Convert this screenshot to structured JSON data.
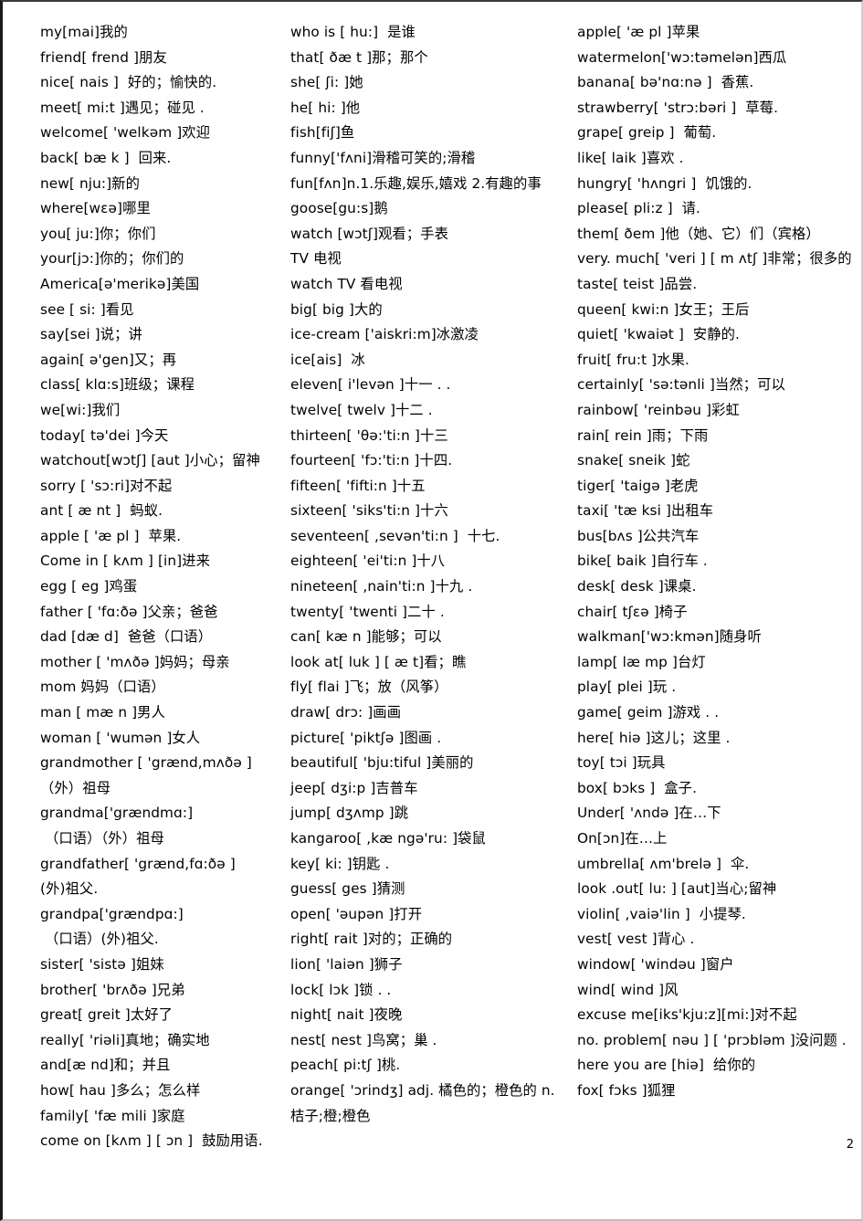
{
  "document": {
    "type": "vocabulary-word-list",
    "page_number": "2",
    "column_count": 3
  },
  "columns": [
    {
      "id": "column-1",
      "entries": [
        "my[mai]我的",
        "friend[ frend ]朋友",
        "nice[ nais ]  好的；愉快的.",
        "meet[ mi:t ]遇见；碰见 .",
        "welcome[ 'welkəm ]欢迎",
        "back[ bæ k ]  回来.",
        "new[ nju:]新的",
        "where[wɛə]哪里",
        "you[ ju:]你；你们",
        "your[jɔ:]你的；你们的",
        "America[ə'merikə]美国",
        "see [ si: ]看见",
        "say[sei ]说；讲",
        "again[ ə'gen]又；再",
        "class[ klɑ:s]班级；课程",
        "we[wi:]我们",
        "today[ tə'dei ]今天",
        "watchout[wɔtʃ] [aut ]小心；留神",
        "sorry [ 'sɔ:ri]对不起",
        "ant [ æ nt ]  蚂蚁.",
        "apple [ 'æ pl ]  苹果.",
        "Come in [ kʌm ] [in]进来",
        "egg [ eg ]鸡蛋",
        "father [ 'fɑ:ðə ]父亲；爸爸",
        "dad [dæ d]  爸爸（口语）",
        "mother [ 'mʌðə ]妈妈；母亲",
        "mom 妈妈（口语）",
        "man [ mæ n ]男人",
        "woman [ 'wumən ]女人",
        "grandmother [ 'grænd,mʌðə ]（外）祖母",
        "grandma['grændmɑ:]",
        " （口语）（外）祖母",
        "grandfather[ 'grænd,fɑ:ðə ]",
        "(外)祖父.",
        "grandpa['grændpɑ:]",
        " （口语）(外)祖父.",
        "sister[ 'sistə ]姐妹",
        "brother[ 'brʌðə ]兄弟",
        "great[ greit ]太好了",
        "really[ 'riəli]真地；确实地",
        "and[æ nd]和；并且",
        "how[ hau ]多么；怎么样",
        "family[ 'fæ mili ]家庭",
        "come on [kʌm ] [ ɔn ]  鼓励用语."
      ]
    },
    {
      "id": "column-2",
      "entries": [
        "who is [ hu:]  是谁",
        "that[ ðæ t ]那；那个",
        "she[ ʃi: ]她",
        "he[ hi: ]他",
        "fish[fiʃ]鱼",
        "funny['fʌni]滑稽可笑的;滑稽",
        "fun[fʌn]n.1.乐趣,娱乐,嬉戏 2.有趣的事",
        "goose[gu:s]鹅",
        "watch [wɔtʃ]观看；手表",
        "TV 电视",
        "watch TV 看电视",
        "big[ big ]大的",
        "ice-cream ['aiskri:m]冰激凌",
        "ice[ais]  冰",
        "eleven[ i'levən ]十一 . .",
        "twelve[ twelv ]十二 .",
        "thirteen[ 'θə:'ti:n ]十三",
        "fourteen[ 'fɔ:'ti:n ]十四.",
        "fifteen[ 'fifti:n ]十五",
        "sixteen[ 'siks'ti:n ]十六",
        "seventeen[ ,sevən'ti:n ]  十七.",
        "eighteen[ 'ei'ti:n ]十八",
        "nineteen[ ,nain'ti:n ]十九 .",
        "twenty[ 'twenti ]二十 .",
        "can[ kæ n ]能够；可以",
        "look at[ luk ] [ æ t]看；瞧",
        "fly[ flai ]飞；放（风筝）",
        "draw[ drɔ: ]画画",
        "picture[ 'piktʃə ]图画 .",
        "beautiful[ 'bju:tiful ]美丽的",
        "jeep[ dʒi:p ]吉普车",
        "jump[ dʒʌmp ]跳",
        "kangaroo[ ,kæ ngə'ru: ]袋鼠",
        "key[ ki: ]钥匙 .",
        "guess[ ges ]猜测",
        "open[ 'əupən ]打开",
        "right[ rait ]对的；正确的",
        "lion[ 'laiən ]狮子",
        "lock[ lɔk ]锁 . .",
        "night[ nait ]夜晚",
        "nest[ nest ]鸟窝；巢 .",
        "peach[ pi:tʃ ]桃.",
        "orange[ 'ɔrindʒ] adj. 橘色的；橙色的 n.桔子;橙;橙色"
      ]
    },
    {
      "id": "column-3",
      "entries": [
        "apple[ 'æ pl ]苹果",
        "watermelon['wɔ:təmelən]西瓜",
        "banana[ bə'nɑ:nə ]  香蕉.",
        "strawberry[ 'strɔ:bəri ]  草莓.",
        "grape[ greip ]  葡萄.",
        "like[ laik ]喜欢 .",
        "hungry[ 'hʌngri ]  饥饿的.",
        "please[ pli:z ]  请.",
        "them[ ðem ]他（她、它）们（宾格）",
        "very. much[ 'veri ] [ m ʌtʃ ]非常；很多的",
        "taste[ teist ]品尝.",
        "queen[ kwi:n ]女王；王后",
        "quiet[ 'kwaiət ]  安静的.",
        "fruit[ fru:t ]水果.",
        "certainly[ 'sə:tənli ]当然；可以",
        "rainbow[ 'reinbəu ]彩虹",
        "rain[ rein ]雨；下雨",
        "snake[ sneik ]蛇",
        "tiger[ 'taigə ]老虎",
        "taxi[ 'tæ ksi ]出租车",
        "bus[bʌs ]公共汽车",
        "bike[ baik ]自行车 .",
        "desk[ desk ]课桌.",
        "chair[ tʃɛə ]椅子",
        "walkman['wɔ:kmən]随身听",
        "lamp[ læ mp ]台灯",
        "play[ plei ]玩 .",
        "game[ geim ]游戏 . .",
        "here[ hiə ]这儿；这里 .",
        "toy[ tɔi ]玩具",
        "box[ bɔks ]  盒子.",
        "Under[ 'ʌndə ]在…下",
        "On[ɔn]在…上",
        "umbrella[ ʌm'brelə ]  伞.",
        "look .out[ lu: ] [aut]当心;留神",
        "violin[ ,vaiə'lin ]  小提琴.",
        "vest[ vest ]背心 .",
        "window[ 'windəu ]窗户",
        "wind[ wind ]风",
        "excuse me[iks'kju:z][mi:]对不起",
        "no. problem[ nəu ] [ 'prɔbləm ]没问题 .",
        "here you are [hiə]  给你的",
        "fox[ fɔks ]狐狸"
      ]
    }
  ]
}
